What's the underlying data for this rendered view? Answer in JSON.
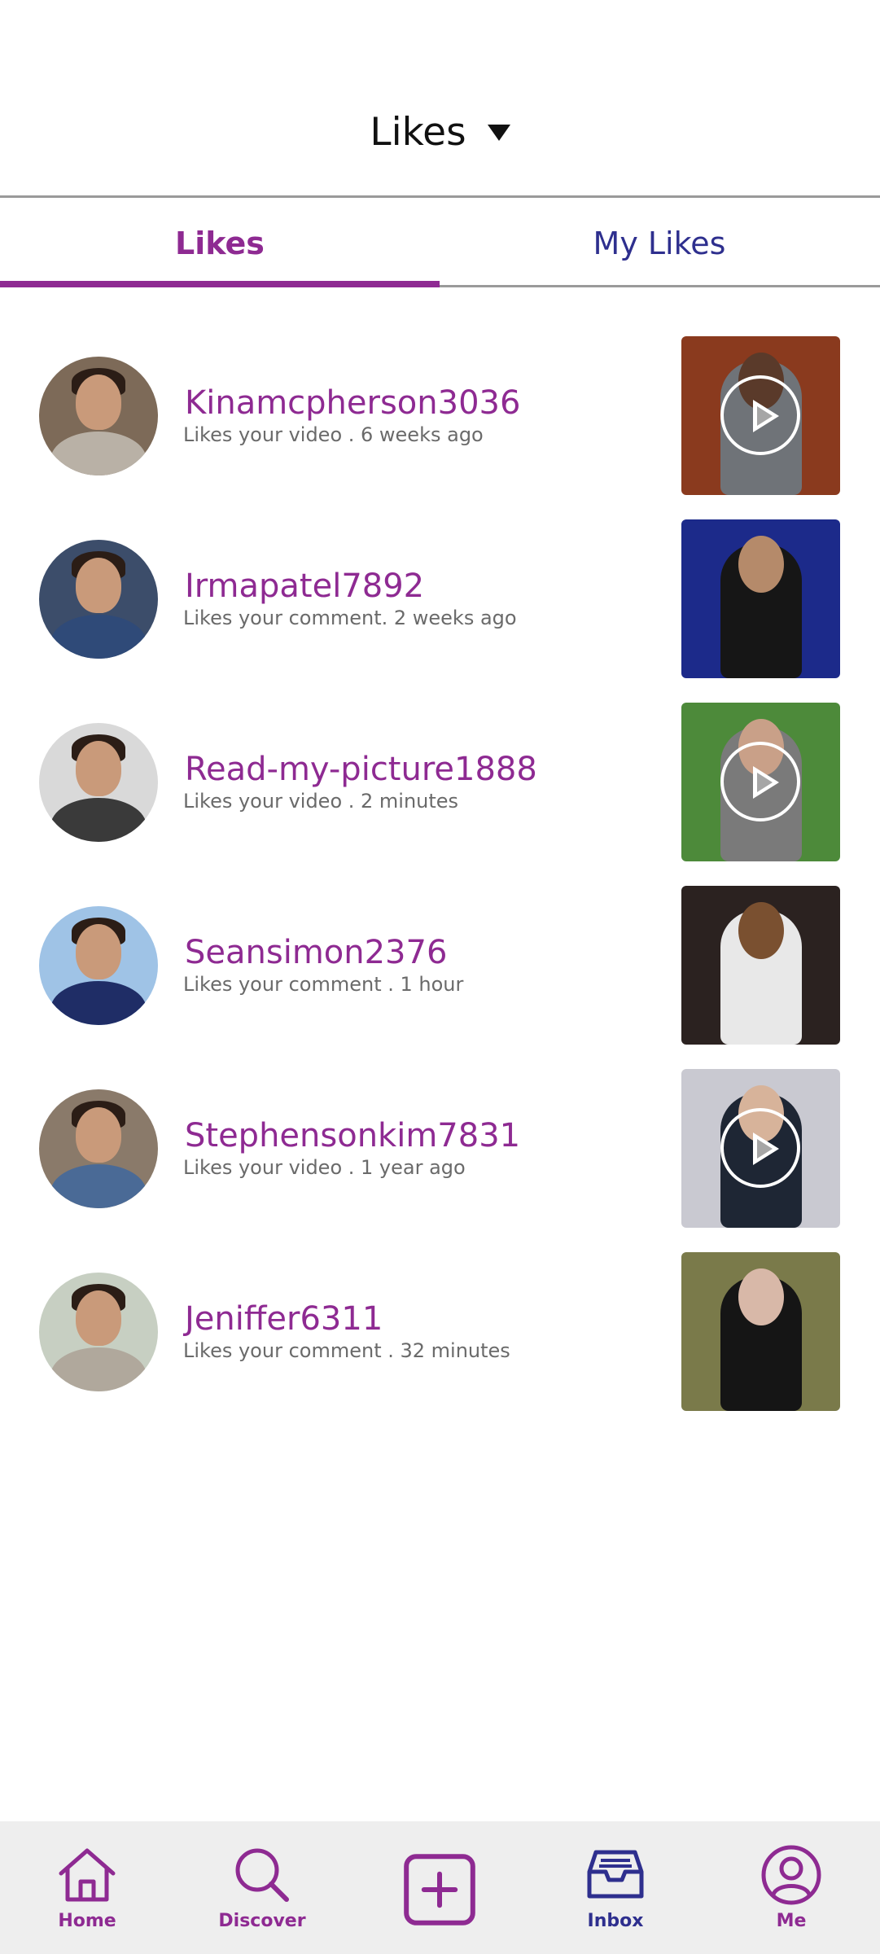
{
  "header": {
    "title": "Likes",
    "dropdown_icon": "caret-down-icon"
  },
  "tabs": [
    {
      "label": "Likes",
      "active": true
    },
    {
      "label": "My Likes",
      "active": false
    }
  ],
  "items": [
    {
      "name": "Kinamcpherson3036",
      "subtitle": "Likes your video . 6 weeks ago",
      "has_play": true
    },
    {
      "name": "Irmapatel7892",
      "subtitle": "Likes your comment. 2 weeks ago",
      "has_play": false
    },
    {
      "name": "Read-my-picture1888",
      "subtitle": "Likes your video . 2 minutes",
      "has_play": true
    },
    {
      "name": "Seansimon2376",
      "subtitle": "Likes your comment . 1 hour",
      "has_play": false
    },
    {
      "name": "Stephensonkim7831",
      "subtitle": "Likes your video . 1 year ago",
      "has_play": true
    },
    {
      "name": "Jeniffer6311",
      "subtitle": "Likes your comment . 32 minutes",
      "has_play": false
    }
  ],
  "nav": [
    {
      "label": "Home",
      "icon": "home-icon",
      "color": "#8e2a92"
    },
    {
      "label": "Discover",
      "icon": "search-icon",
      "color": "#8e2a92"
    },
    {
      "label": "",
      "icon": "add-icon",
      "color": "#8e2a92"
    },
    {
      "label": "Inbox",
      "icon": "inbox-icon",
      "color": "#2e2f8e"
    },
    {
      "label": "Me",
      "icon": "profile-icon",
      "color": "#8e2a92"
    }
  ],
  "colors": {
    "accent": "#8e2a92",
    "secondary": "#2e2f8e",
    "nav_bg": "#eeeeee"
  }
}
